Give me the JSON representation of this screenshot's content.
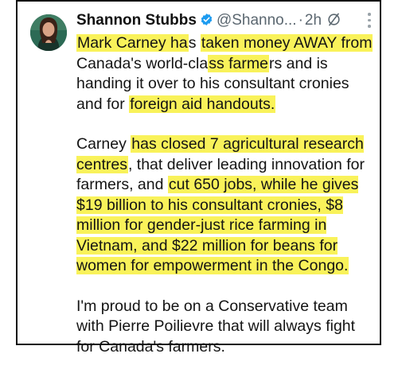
{
  "post": {
    "author_name": "Shannon Stubbs",
    "handle": "@Shanno...",
    "separator": "·",
    "time": "2h",
    "icons": {
      "verified": "verified-badge-icon",
      "grok": "grok-icon",
      "more": "more-options-icon"
    },
    "colors": {
      "highlight": "#f9f25a",
      "verified": "#1d9bf0",
      "text": "#141414",
      "secondary": "#5b6770"
    },
    "paragraphs": [
      [
        {
          "text": "Mark Carney ha",
          "hl": true
        },
        {
          "text": "s ",
          "hl": false
        },
        {
          "text": "taken money AWAY from",
          "hl": true
        },
        {
          "text": " Canada's world-cla",
          "hl": false
        },
        {
          "text": "ss farme",
          "hl": true
        },
        {
          "text": "rs and is handing it over to his consultant cronies and for ",
          "hl": false
        },
        {
          "text": "foreign aid handouts.",
          "hl": true
        }
      ],
      [
        {
          "text": "Carney ",
          "hl": false
        },
        {
          "text": "has closed 7 agricultural research centres",
          "hl": true
        },
        {
          "text": ", that deliver leading innovation for farmers, and ",
          "hl": false
        },
        {
          "text": "cut 650 jobs, while he gives $19 billion to his consultant cronies, $8 million for gender-just rice farming in Vietnam, and $22 million for beans for women for empowerment in the Congo.",
          "hl": true
        }
      ],
      [
        {
          "text": "I'm proud to be on a Conservative team with Pierre Poilievre that will always fight for Canada's farmers.",
          "hl": false
        }
      ]
    ]
  }
}
